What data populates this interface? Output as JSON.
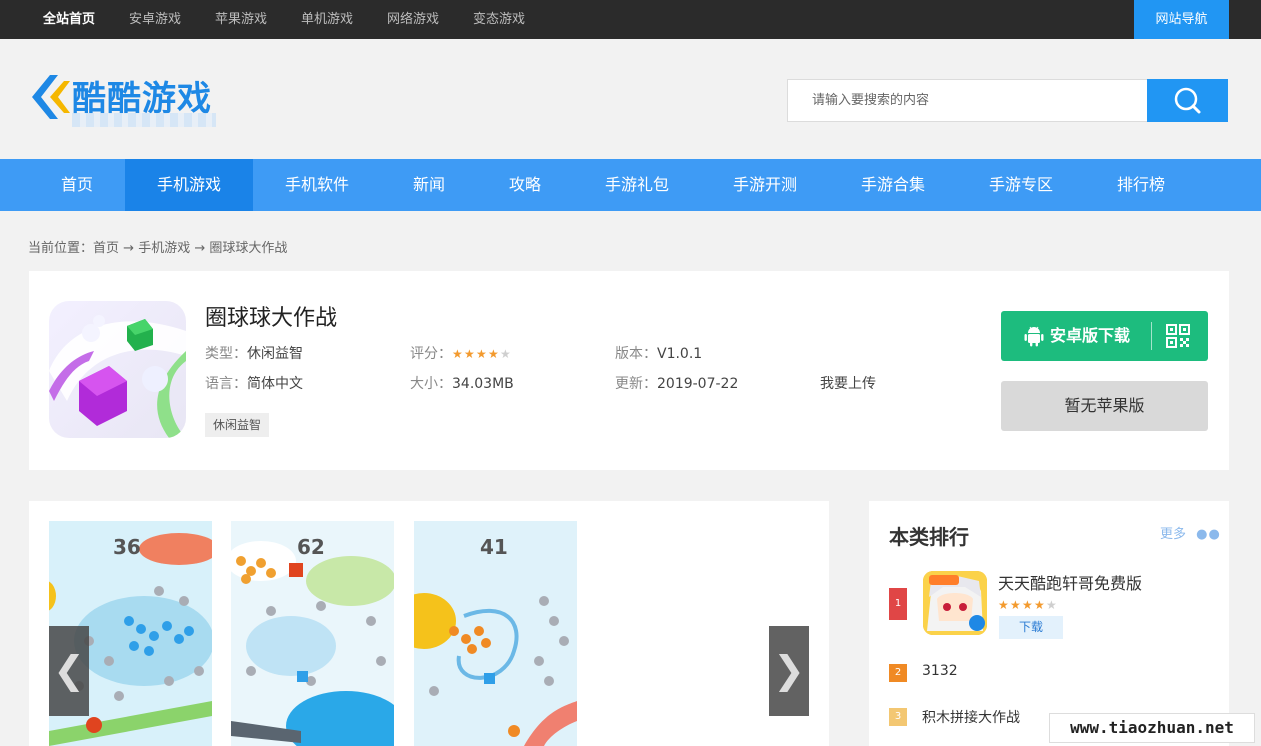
{
  "topbar": {
    "links": [
      "全站首页",
      "安卓游戏",
      "苹果游戏",
      "单机游戏",
      "网络游戏",
      "变态游戏"
    ],
    "site_nav": "网站导航"
  },
  "logo": {
    "text": "酷酷游戏"
  },
  "search": {
    "placeholder": "请输入要搜索的内容",
    "icon": "search-icon"
  },
  "mainnav": {
    "items": [
      "首页",
      "手机游戏",
      "手机软件",
      "新闻",
      "攻略",
      "手游礼包",
      "手游开测",
      "手游合集",
      "手游专区",
      "排行榜"
    ],
    "active": "手机游戏"
  },
  "breadcrumb": {
    "prefix": "当前位置：",
    "items": [
      "首页",
      "手机游戏",
      "圈球球大作战"
    ],
    "separator": "→"
  },
  "app": {
    "title": "圈球球大作战",
    "type_label": "类型：",
    "type_value": "休闲益智",
    "rating_label": "评分：",
    "rating_stars": 4,
    "rating_max": 5,
    "version_label": "版本：",
    "version_value": "V1.0.1",
    "language_label": "语言：",
    "language_value": "简体中文",
    "size_label": "大小：",
    "size_value": "34.03MB",
    "update_label": "更新：",
    "update_value": "2019-07-22",
    "upload_link": "我要上传",
    "tag": "休闲益智",
    "android_button": "安卓版下载",
    "ios_button": "暂无苹果版"
  },
  "screenshots": {
    "scores": [
      "36",
      "62",
      "41"
    ],
    "prev_arrow": "❮",
    "next_arrow": "❯"
  },
  "ranking": {
    "title": "本类排行",
    "more": "更多",
    "items": [
      {
        "rank": "1",
        "name": "天天酷跑轩哥免费版",
        "stars": 4,
        "download": "下载",
        "color": "#e04646"
      },
      {
        "rank": "2",
        "name": "3132",
        "color": "#f08a24"
      },
      {
        "rank": "3",
        "name": "积木拼接大作战",
        "color": "#f3c772"
      }
    ]
  },
  "watermark": "www.tiaozhuan.net",
  "colors": {
    "topbar": "#2b2b2b",
    "brand_blue": "#3e9bf5",
    "android_green": "#1dbc7e",
    "star": "#f39a2e"
  }
}
